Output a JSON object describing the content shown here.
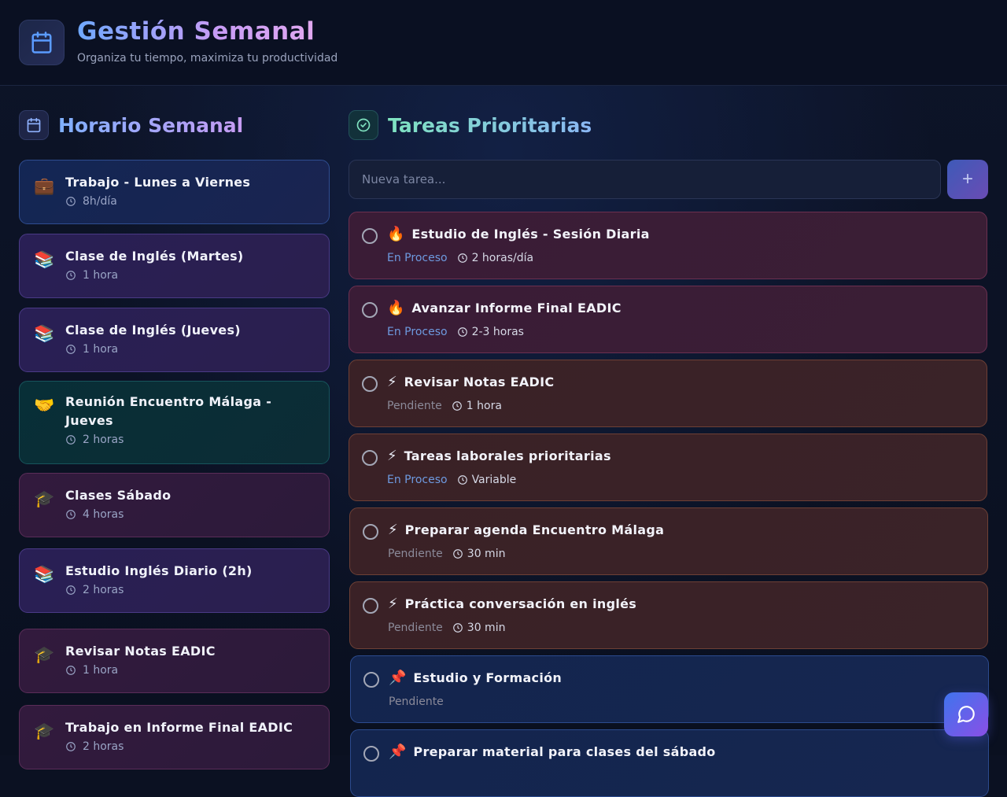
{
  "header": {
    "title": "Gestión Semanal",
    "subtitle": "Organiza tu tiempo, maximiza tu productividad"
  },
  "schedule": {
    "title": "Horario Semanal",
    "items": [
      {
        "emoji": "💼",
        "title": "Trabajo - Lunes a Viernes",
        "duration": "8h/día",
        "color": "blue"
      },
      {
        "emoji": "📚",
        "title": "Clase de Inglés (Martes)",
        "duration": "1 hora",
        "color": "purple"
      },
      {
        "emoji": "📚",
        "title": "Clase de Inglés (Jueves)",
        "duration": "1 hora",
        "color": "purple"
      },
      {
        "emoji": "🤝",
        "title": "Reunión Encuentro Málaga - Jueves",
        "duration": "2 horas",
        "color": "teal"
      },
      {
        "emoji": "🎓",
        "title": "Clases Sábado",
        "duration": "4 horas",
        "color": "wine"
      },
      {
        "emoji": "📚",
        "title": "Estudio Inglés Diario (2h)",
        "duration": "2 horas",
        "color": "purple"
      },
      {
        "emoji": "🎓",
        "title": "Revisar Notas EADIC",
        "duration": "1 hora",
        "color": "wine"
      },
      {
        "emoji": "🎓",
        "title": "Trabajo en Informe Final EADIC",
        "duration": "2 horas",
        "color": "wine"
      }
    ]
  },
  "tasks": {
    "title": "Tareas Prioritarias",
    "input_placeholder": "Nueva tarea...",
    "add_label": "+",
    "items": [
      {
        "emoji": "🔥",
        "title": "Estudio de Inglés - Sesión Diaria",
        "status": "En Proceso",
        "duration": "2 horas/día",
        "color": "red"
      },
      {
        "emoji": "🔥",
        "title": "Avanzar Informe Final EADIC",
        "status": "En Proceso",
        "duration": "2-3 horas",
        "color": "red"
      },
      {
        "emoji": "⚡",
        "title": "Revisar Notas EADIC",
        "status": "Pendiente",
        "duration": "1 hora",
        "color": "amber"
      },
      {
        "emoji": "⚡",
        "title": "Tareas laborales prioritarias",
        "status": "En Proceso",
        "duration": "Variable",
        "color": "amber"
      },
      {
        "emoji": "⚡",
        "title": "Preparar agenda Encuentro Málaga",
        "status": "Pendiente",
        "duration": "30 min",
        "color": "amber"
      },
      {
        "emoji": "⚡",
        "title": "Práctica conversación en inglés",
        "status": "Pendiente",
        "duration": "30 min",
        "color": "amber"
      },
      {
        "emoji": "📌",
        "title": "Estudio y Formación",
        "status": "Pendiente",
        "duration": "",
        "color": "navy"
      },
      {
        "emoji": "📌",
        "title": "Preparar material para clases del sábado",
        "status": "",
        "duration": "",
        "color": "navy"
      }
    ]
  }
}
